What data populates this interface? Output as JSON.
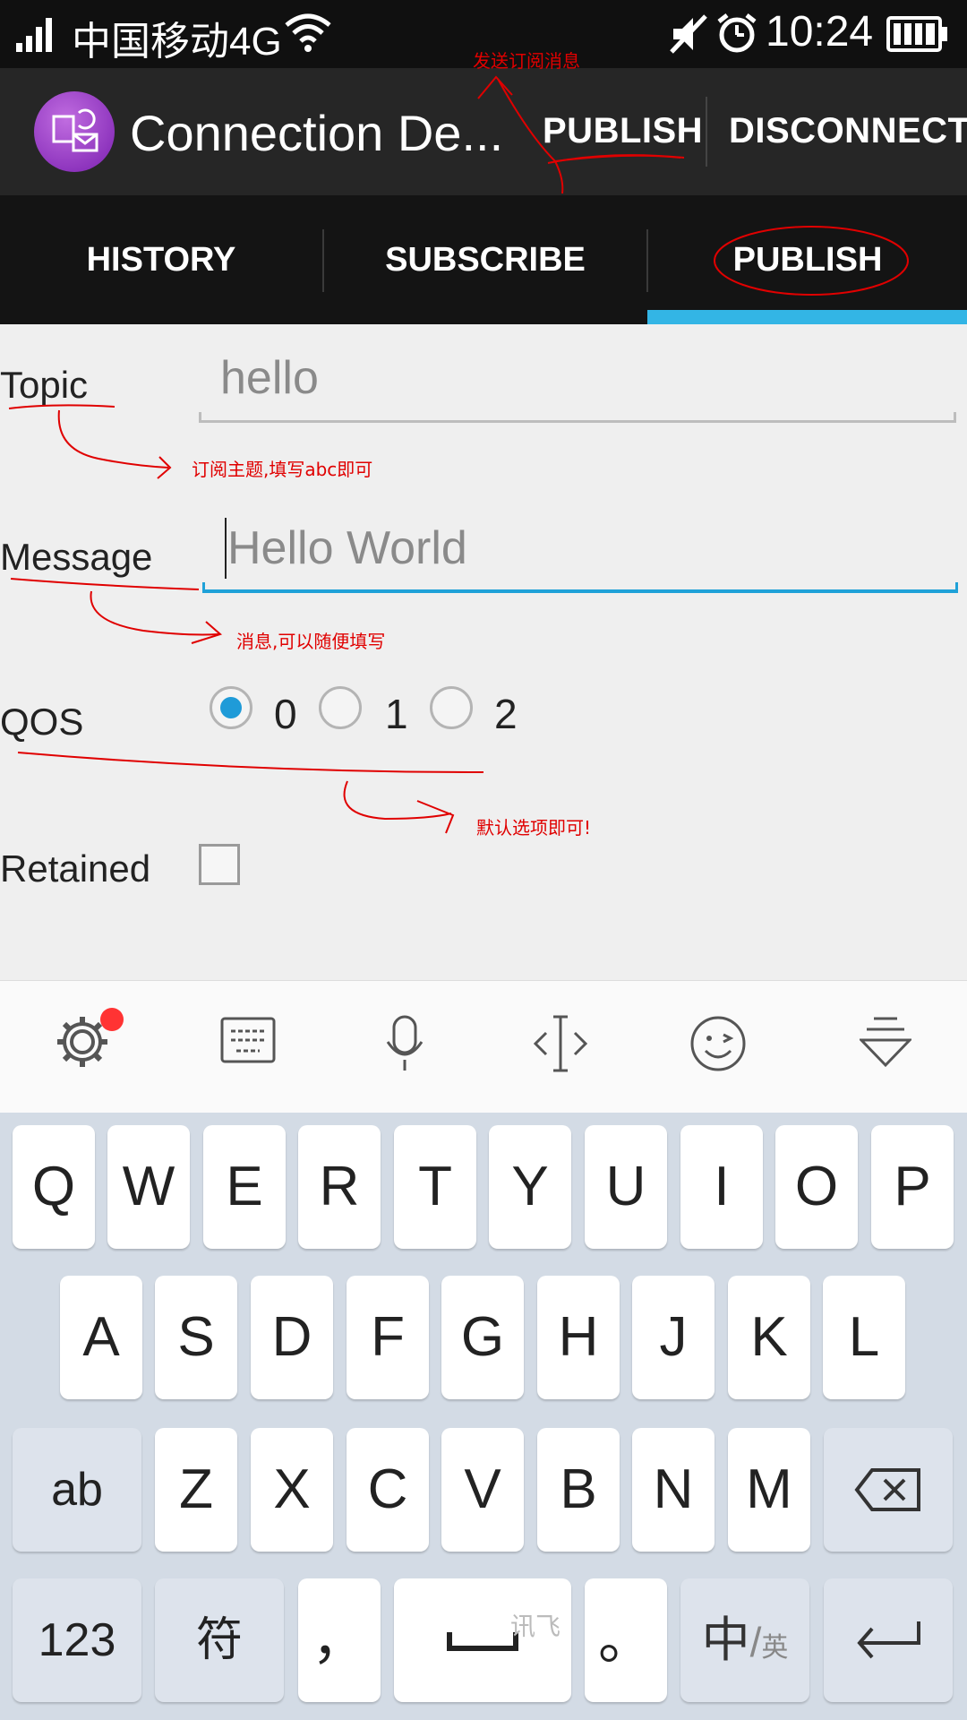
{
  "status_bar": {
    "carrier": "中国移动4G",
    "time": "10:24"
  },
  "action_bar": {
    "title": "Connection De...",
    "publish_label": "PUBLISH",
    "disconnect_label": "DISCONNECT"
  },
  "tabs": [
    {
      "label": "HISTORY"
    },
    {
      "label": "SUBSCRIBE"
    },
    {
      "label": "PUBLISH",
      "selected": true
    }
  ],
  "form": {
    "topic_label": "Topic",
    "topic_value": "hello",
    "message_label": "Message",
    "message_placeholder": "Hello World",
    "qos_label": "QOS",
    "qos_options": [
      "0",
      "1",
      "2"
    ],
    "qos_selected": "0",
    "retained_label": "Retained",
    "retained_checked": false
  },
  "annotations": {
    "send": "发送订阅消息",
    "topic": "订阅主题,填写abc即可",
    "message": "消息,可以随便填写",
    "qos": "默认选项即可!"
  },
  "keyboard": {
    "row1": [
      "Q",
      "W",
      "E",
      "R",
      "T",
      "Y",
      "U",
      "I",
      "O",
      "P"
    ],
    "row2": [
      "A",
      "S",
      "D",
      "F",
      "G",
      "H",
      "J",
      "K",
      "L"
    ],
    "row3": [
      "Z",
      "X",
      "C",
      "V",
      "B",
      "N",
      "M"
    ],
    "shift_label": "ab",
    "num_label": "123",
    "sym_label": "符",
    "comma_label": "，",
    "period_label": "。",
    "lang_label_main": "中",
    "lang_label_sub": "英",
    "space_brand": "讯飞"
  },
  "colors": {
    "accent": "#33b5e5",
    "annotation": "#e00000",
    "radio_on": "#1f9bd8"
  }
}
